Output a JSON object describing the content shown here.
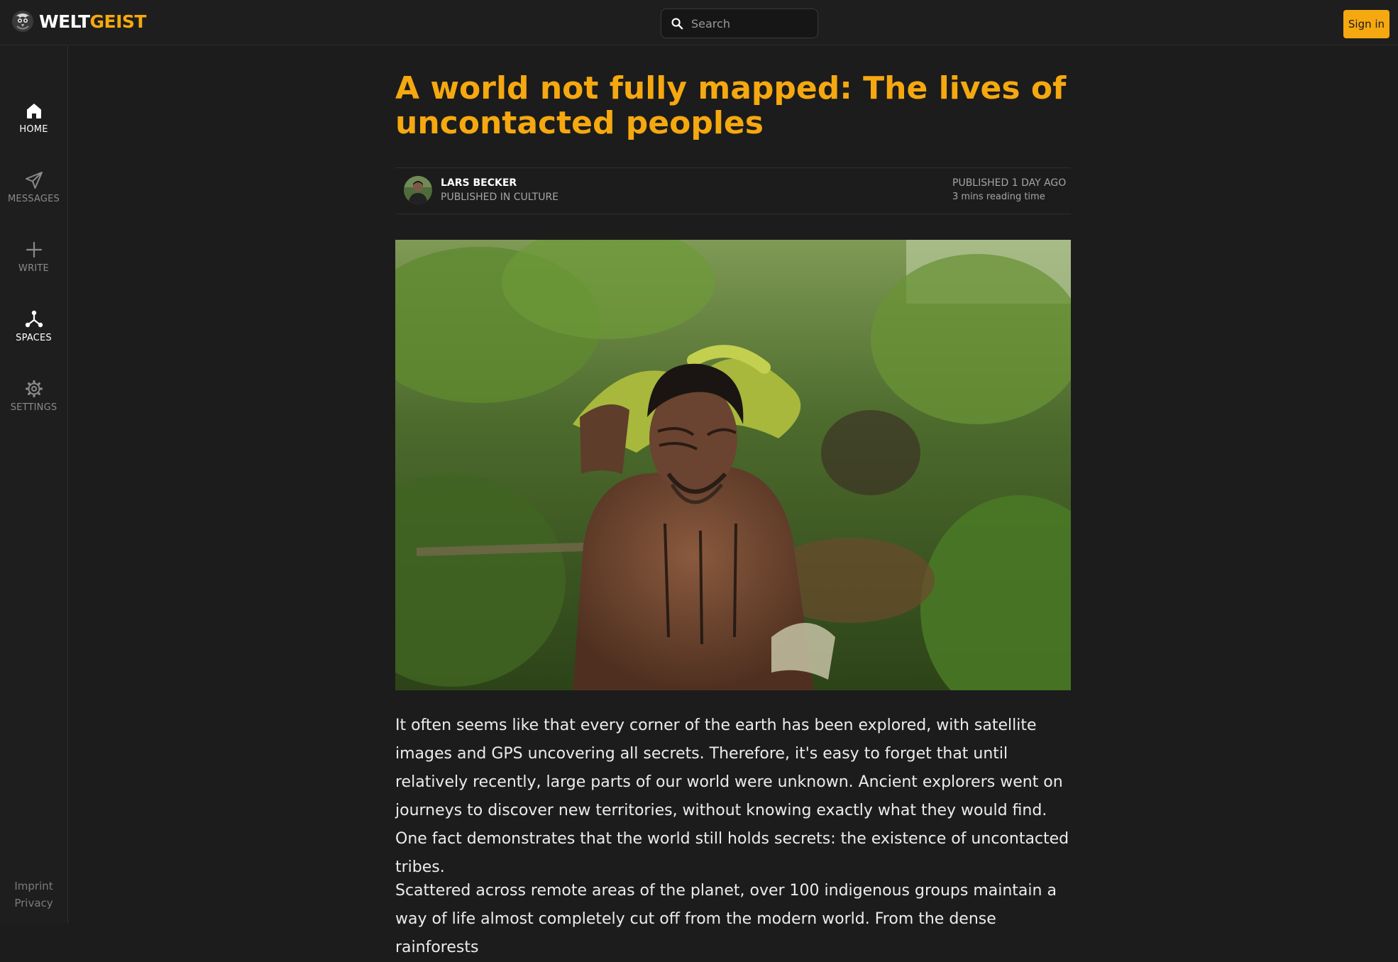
{
  "header": {
    "brand_part1": "WELT",
    "brand_part2": "GEIST",
    "search_placeholder": "Search",
    "signin_label": "Sign in"
  },
  "sidebar": {
    "items": [
      {
        "label": "HOME",
        "icon": "home-icon",
        "active": true
      },
      {
        "label": "MESSAGES",
        "icon": "paper-plane-icon",
        "active": false
      },
      {
        "label": "WRITE",
        "icon": "plus-icon",
        "active": false
      },
      {
        "label": "SPACES",
        "icon": "network-icon",
        "active": true
      },
      {
        "label": "SETTINGS",
        "icon": "gear-icon",
        "active": false
      }
    ],
    "footer_links": [
      "Imprint",
      "Privacy"
    ]
  },
  "article": {
    "title": "A world not fully mapped: The lives of uncontacted peoples",
    "author_name": "LARS BECKER",
    "published_in": "PUBLISHED IN CULTURE",
    "published_date": "PUBLISHED 1 DAY AGO",
    "reading_time": "3 mins reading time",
    "paragraphs": [
      "It often seems like that every corner of the earth has been explored, with satellite images and GPS uncovering all secrets. Therefore, it's easy to forget that until relatively recently, large parts of our world were unknown. Ancient explorers went on journeys to discover new territories, without knowing exactly what they would find. One fact demonstrates that the world still holds secrets: the existence of uncontacted tribes.",
      "Scattered across remote areas of the planet, over 100 indigenous groups maintain a way of life almost completely cut off from the modern world. From the dense rainforests"
    ]
  },
  "colors": {
    "accent": "#f5a80f",
    "background": "#1c1c1c",
    "panel": "#1e1e1e"
  }
}
